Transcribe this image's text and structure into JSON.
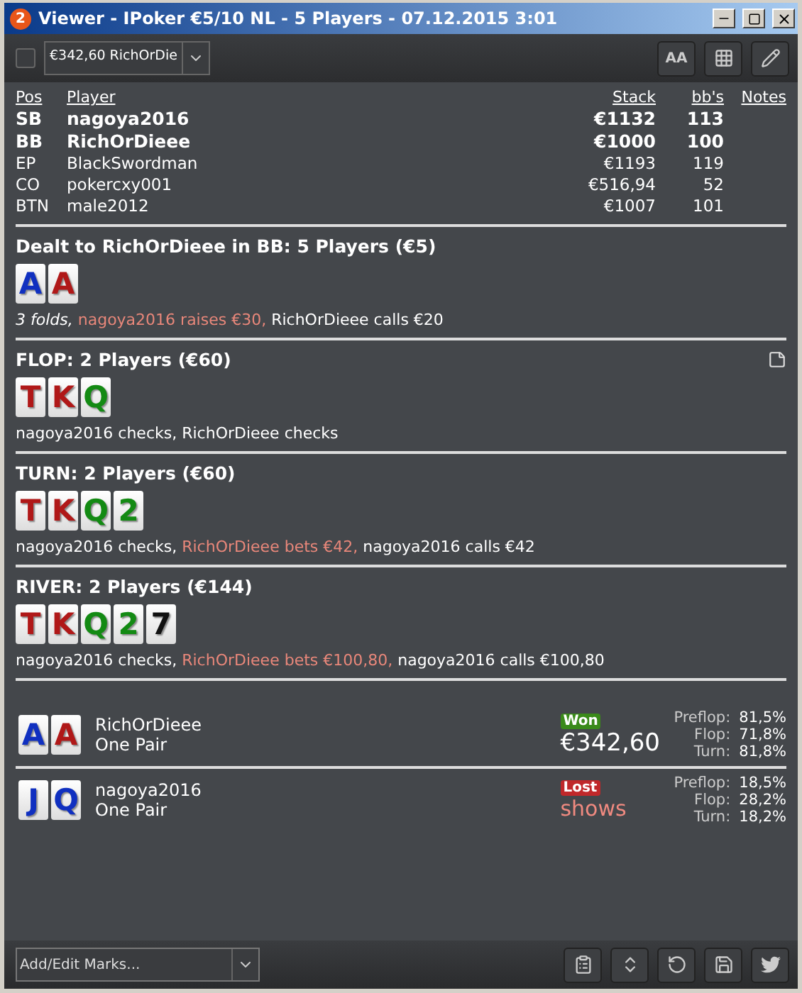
{
  "window": {
    "badge": "2",
    "title": "Viewer - IPoker €5/10 NL - 5 Players - 07.12.2015 3:01"
  },
  "toolbar": {
    "checked": false,
    "hand_select": "€342,60 RichOrDie",
    "font_button": "AA"
  },
  "players": {
    "columns": [
      "Pos",
      "Player",
      "Stack",
      "bb's",
      "Notes"
    ],
    "rows": [
      {
        "pos": "SB",
        "name": "nagoya2016",
        "stack": "€1132",
        "bbs": "113",
        "emphasized": true
      },
      {
        "pos": "BB",
        "name": "RichOrDieee",
        "stack": "€1000",
        "bbs": "100",
        "emphasized": true
      },
      {
        "pos": "EP",
        "name": "BlackSwordman",
        "stack": "€1193",
        "bbs": "119",
        "emphasized": false
      },
      {
        "pos": "CO",
        "name": "pokercxy001",
        "stack": "€516,94",
        "bbs": "52",
        "emphasized": false
      },
      {
        "pos": "BTN",
        "name": "male2012",
        "stack": "€1007",
        "bbs": "101",
        "emphasized": false
      }
    ]
  },
  "streets": [
    {
      "title": "Dealt to RichOrDieee in BB: 5 Players (€5)",
      "note": false,
      "cards": [
        {
          "rank": "A",
          "color": "#1030c0"
        },
        {
          "rank": "A",
          "color": "#b01818"
        }
      ],
      "actions": [
        {
          "kind": "italic",
          "text": "3 folds, "
        },
        {
          "kind": "highlight",
          "text": "nagoya2016 raises €30, "
        },
        {
          "kind": "normal",
          "text": "RichOrDieee calls €20"
        }
      ]
    },
    {
      "title": "FLOP: 2 Players (€60)",
      "note": true,
      "cards": [
        {
          "rank": "T",
          "color": "#b01818"
        },
        {
          "rank": "K",
          "color": "#b01818"
        },
        {
          "rank": "Q",
          "color": "#138a13"
        }
      ],
      "actions": [
        {
          "kind": "normal",
          "text": "nagoya2016 checks, RichOrDieee checks"
        }
      ]
    },
    {
      "title": "TURN: 2 Players (€60)",
      "note": false,
      "cards": [
        {
          "rank": "T",
          "color": "#b01818"
        },
        {
          "rank": "K",
          "color": "#b01818"
        },
        {
          "rank": "Q",
          "color": "#138a13"
        },
        {
          "rank": "2",
          "color": "#138a13"
        }
      ],
      "actions": [
        {
          "kind": "normal",
          "text": "nagoya2016 checks, "
        },
        {
          "kind": "highlight",
          "text": "RichOrDieee bets €42, "
        },
        {
          "kind": "normal",
          "text": "nagoya2016 calls €42"
        }
      ]
    },
    {
      "title": "RIVER: 2 Players (€144)",
      "note": false,
      "cards": [
        {
          "rank": "T",
          "color": "#b01818"
        },
        {
          "rank": "K",
          "color": "#b01818"
        },
        {
          "rank": "Q",
          "color": "#138a13"
        },
        {
          "rank": "2",
          "color": "#138a13"
        },
        {
          "rank": "7",
          "color": "#111111"
        }
      ],
      "actions": [
        {
          "kind": "normal",
          "text": "nagoya2016 checks, "
        },
        {
          "kind": "highlight",
          "text": "RichOrDieee bets €100,80, "
        },
        {
          "kind": "normal",
          "text": "nagoya2016 calls €100,80"
        }
      ]
    }
  ],
  "results": [
    {
      "name": "RichOrDieee",
      "hand": "One Pair",
      "won": true,
      "badge": "Won",
      "amount": "€342,60",
      "cards": [
        {
          "rank": "A",
          "color": "#1030c0"
        },
        {
          "rank": "A",
          "color": "#b01818"
        }
      ],
      "stats": [
        {
          "label": "Preflop:",
          "value": "81,5%"
        },
        {
          "label": "Flop:",
          "value": "71,8%"
        },
        {
          "label": "Turn:",
          "value": "81,8%"
        }
      ]
    },
    {
      "name": "nagoya2016",
      "hand": "One Pair",
      "won": false,
      "badge": "Lost",
      "amount": "shows",
      "cards": [
        {
          "rank": "J",
          "color": "#1030c0"
        },
        {
          "rank": "Q",
          "color": "#1030c0"
        }
      ],
      "stats": [
        {
          "label": "Preflop:",
          "value": "18,5%"
        },
        {
          "label": "Flop:",
          "value": "28,2%"
        },
        {
          "label": "Turn:",
          "value": "18,2%"
        }
      ]
    }
  ],
  "footer": {
    "marks_placeholder": "Add/Edit Marks..."
  }
}
